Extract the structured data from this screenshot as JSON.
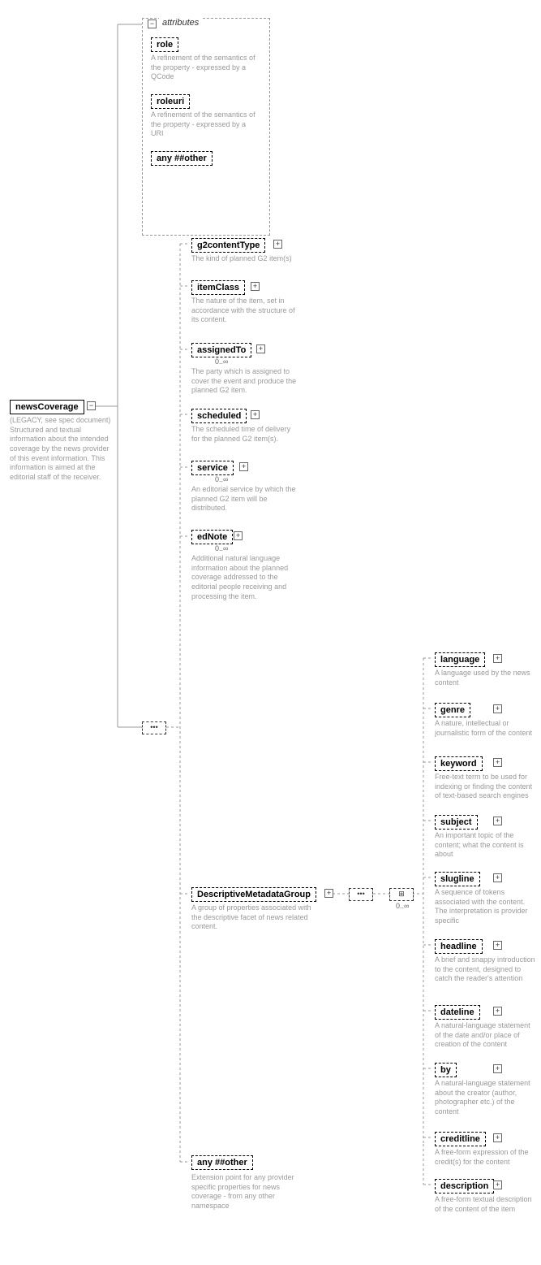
{
  "root": {
    "label": "newsCoverage",
    "desc": "(LEGACY, see spec document) Structured and textual information about the intended coverage by the news provider of this event information. This information is aimed at the editorial staff of the receiver."
  },
  "attributes": {
    "label": "attributes"
  },
  "attr_items": [
    {
      "label": "role",
      "desc": "A refinement of the semantics of the property - expressed by a QCode"
    },
    {
      "label": "roleuri",
      "desc": "A refinement of the semantics of the property - expressed by a URI"
    },
    {
      "label": "any ##other"
    }
  ],
  "seq": [
    {
      "label": "g2contentType",
      "desc": "The kind of planned G2 item(s)",
      "card": ""
    },
    {
      "label": "itemClass",
      "desc": "The nature of the item, set in accordance with the structure of its content.",
      "card": ""
    },
    {
      "label": "assignedTo",
      "desc": "The party which is assigned to cover the event and produce the planned G2 item.",
      "card": "0..∞"
    },
    {
      "label": "scheduled",
      "desc": "The scheduled time of delivery for the planned G2 item(s).",
      "card": ""
    },
    {
      "label": "service",
      "desc": "An editorial service by which the planned G2 item will be distributed.",
      "card": "0..∞"
    },
    {
      "label": "edNote",
      "desc": "Additional natural language information about the planned coverage addressed to the editorial people receiving and processing the item.",
      "card": "0..∞"
    }
  ],
  "dmg": {
    "label": "DescriptiveMetadataGroup",
    "desc": "A group of properties associated with the descriptive facet of news related content.",
    "card": "0..∞"
  },
  "dmg_children": [
    {
      "label": "language",
      "desc": "A language used by the news content"
    },
    {
      "label": "genre",
      "desc": "A nature, intellectual or journalistic form of the content"
    },
    {
      "label": "keyword",
      "desc": "Free-text term to be used for indexing or finding the content of text-based search engines"
    },
    {
      "label": "subject",
      "desc": "An important topic of the content; what the content is about"
    },
    {
      "label": "slugline",
      "desc": "A sequence of tokens associated with the content. The interpretation is provider specific"
    },
    {
      "label": "headline",
      "desc": "A brief and snappy introduction to the content, designed to catch the reader's attention"
    },
    {
      "label": "dateline",
      "desc": "A natural-language statement of the date and/or place of creation of the content"
    },
    {
      "label": "by",
      "desc": "A natural-language statement about the creator (author, photographer etc.) of the content"
    },
    {
      "label": "creditline",
      "desc": "A free-form expression of the credit(s) for the content"
    },
    {
      "label": "description",
      "desc": "A free-form textual description of the content of the item"
    }
  ],
  "any_other": {
    "label": "any ##other",
    "desc": "Extension point for any provider specific properties for news coverage - from any other namespace"
  }
}
